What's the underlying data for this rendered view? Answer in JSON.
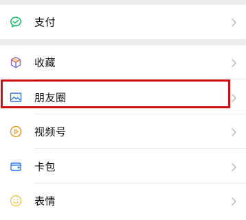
{
  "menu": {
    "payment": {
      "label": "支付",
      "icon": "wechat-pay-icon",
      "color": "#07c160"
    },
    "items": [
      {
        "label": "收藏",
        "icon": "favorites-cube-icon"
      },
      {
        "label": "朋友圈",
        "icon": "moments-photo-icon"
      },
      {
        "label": "视频号",
        "icon": "channels-play-icon",
        "color": "#f39c12"
      },
      {
        "label": "卡包",
        "icon": "card-wallet-icon",
        "color": "#2e7df6"
      },
      {
        "label": "表情",
        "icon": "stickers-smile-icon",
        "color": "#f7c846"
      }
    ],
    "highlight_color": "#d10d12"
  }
}
